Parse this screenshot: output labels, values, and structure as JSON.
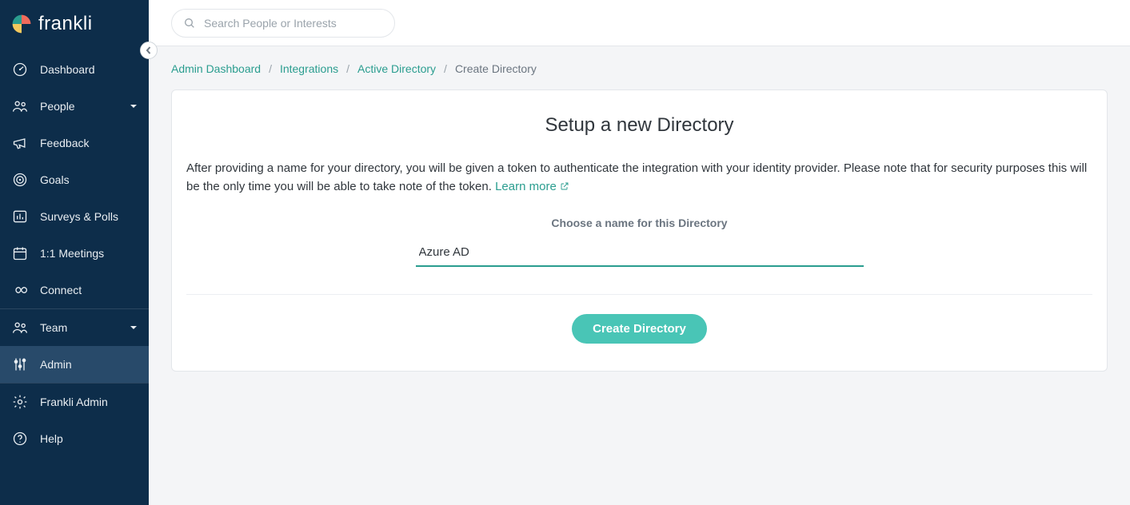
{
  "brand": {
    "name": "frankli"
  },
  "sidebar": {
    "items": [
      {
        "label": "Dashboard"
      },
      {
        "label": "People"
      },
      {
        "label": "Feedback"
      },
      {
        "label": "Goals"
      },
      {
        "label": "Surveys & Polls"
      },
      {
        "label": "1:1 Meetings"
      },
      {
        "label": "Connect"
      },
      {
        "label": "Team"
      },
      {
        "label": "Admin"
      },
      {
        "label": "Frankli Admin"
      },
      {
        "label": "Help"
      }
    ]
  },
  "search": {
    "placeholder": "Search People or Interests"
  },
  "breadcrumb": {
    "items": [
      {
        "label": "Admin Dashboard",
        "link": true
      },
      {
        "label": "Integrations",
        "link": true
      },
      {
        "label": "Active Directory",
        "link": true
      },
      {
        "label": "Create Directory",
        "link": false
      }
    ]
  },
  "page": {
    "title": "Setup a new Directory",
    "description": "After providing a name for your directory, you will be given a token to authenticate the integration with your identity provider. Please note that for security purposes this will be the only time you will be able to take note of the token. ",
    "learn_more": "Learn more",
    "field_label": "Choose a name for this Directory",
    "field_value": "Azure AD",
    "submit_label": "Create Directory"
  }
}
